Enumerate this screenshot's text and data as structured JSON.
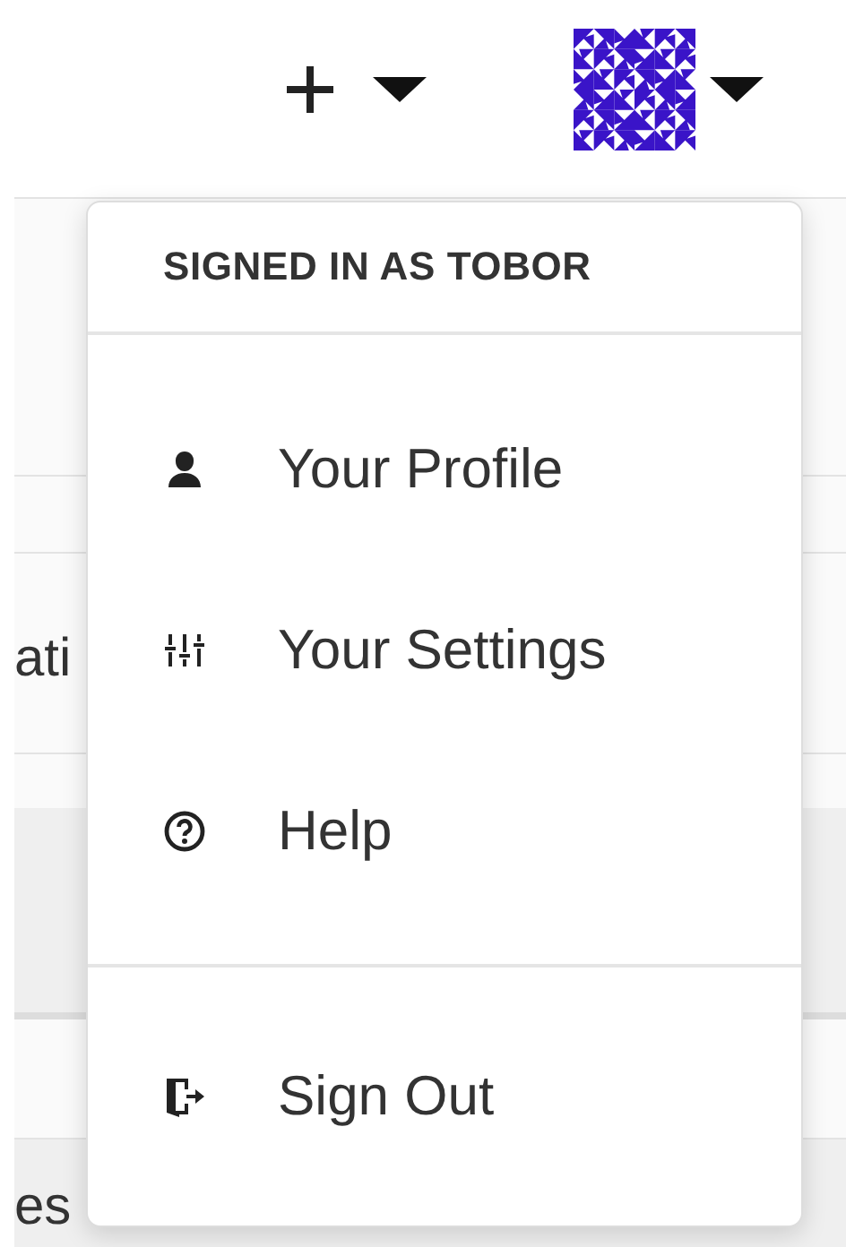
{
  "background": {
    "texts": [
      "ati",
      "es"
    ]
  },
  "user_menu": {
    "header": "SIGNED IN AS TOBOR",
    "sections": [
      {
        "items": [
          {
            "kind": "profile",
            "label": "Your Profile"
          },
          {
            "kind": "settings",
            "label": "Your Settings"
          },
          {
            "kind": "help",
            "label": "Help"
          }
        ]
      },
      {
        "items": [
          {
            "kind": "signout",
            "label": "Sign Out"
          }
        ]
      }
    ]
  }
}
